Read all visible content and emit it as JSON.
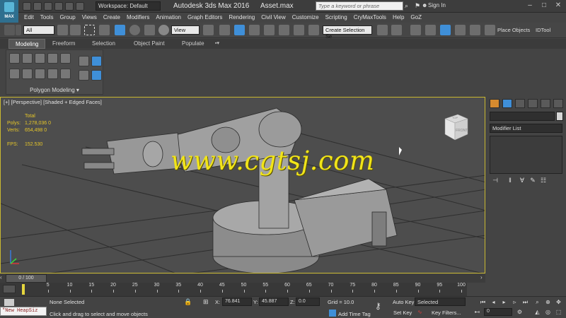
{
  "app": {
    "logo_text": "MAX",
    "workspace": "Workspace: Default",
    "title": "Autodesk 3ds Max 2016",
    "file": "Asset.max",
    "search_placeholder": "Type a keyword or phrase",
    "signin": "Sign In"
  },
  "menu": [
    "Edit",
    "Tools",
    "Group",
    "Views",
    "Create",
    "Modifiers",
    "Animation",
    "Graph Editors",
    "Rendering",
    "Civil View",
    "Customize",
    "Scripting",
    "CryMaxTools",
    "Help",
    "GoZ"
  ],
  "toolbar": {
    "filter_value": "All",
    "coord_value": "View",
    "selection_set": "Create Selection Se",
    "place_objects": "Place Objects",
    "idtool": "IDTool",
    "icons": [
      "undo-icon",
      "redo-icon",
      "link-icon",
      "unlink-icon",
      "select-icon",
      "select-by-name-icon",
      "rect-region-icon",
      "window-crossing-icon",
      "move-icon",
      "rotate-icon",
      "scale-icon",
      "snap-icon",
      "angle-snap-icon",
      "percent-snap-icon",
      "mirror-icon",
      "align-icon",
      "layer-icon",
      "material-editor-icon",
      "render-icon"
    ]
  },
  "ribbon": {
    "tabs": [
      "Modeling",
      "Freeform",
      "Selection",
      "Object Paint",
      "Populate"
    ],
    "panel_label": "Polygon Modeling ▾"
  },
  "viewport": {
    "label": "[+] [Perspective] [Shaded + Edged Faces]",
    "stats": {
      "header": "Total",
      "polys_label": "Polys:",
      "polys_value": "1,278,036  0",
      "verts_label": "Verts:",
      "verts_value": "654,498  0",
      "fps_label": "FPS:",
      "fps_value": "152.530"
    },
    "watermark": "www.cgtsj.com",
    "viewcube_top": "TOP",
    "viewcube_front": "FRONT"
  },
  "command_panel": {
    "modifier_list": "Modifier List"
  },
  "timeline": {
    "slider_label": "0 / 100",
    "ticks": [
      "5",
      "10",
      "15",
      "20",
      "25",
      "30",
      "35",
      "40",
      "45",
      "50",
      "55",
      "60",
      "65",
      "70",
      "75",
      "80",
      "85",
      "90",
      "95",
      "100"
    ]
  },
  "status": {
    "listener_text": "\"New HeapSiz",
    "selection": "None Selected",
    "prompt": "Click and drag to select and move objects",
    "x_label": "X:",
    "x_value": "76.841",
    "y_label": "Y:",
    "y_value": "45.887",
    "z_label": "Z:",
    "z_value": "0.0",
    "grid": "Grid = 10.0",
    "add_time_tag": "Add Time Tag",
    "auto_key": "Auto Key",
    "set_key": "Set Key",
    "selected_value": "Selected",
    "key_filters": "Key Filters...",
    "frame_value": "0"
  },
  "colors": {
    "viewport_border": "#c9b830",
    "stats_text": "#e6c629",
    "watermark": "#f1e419"
  }
}
